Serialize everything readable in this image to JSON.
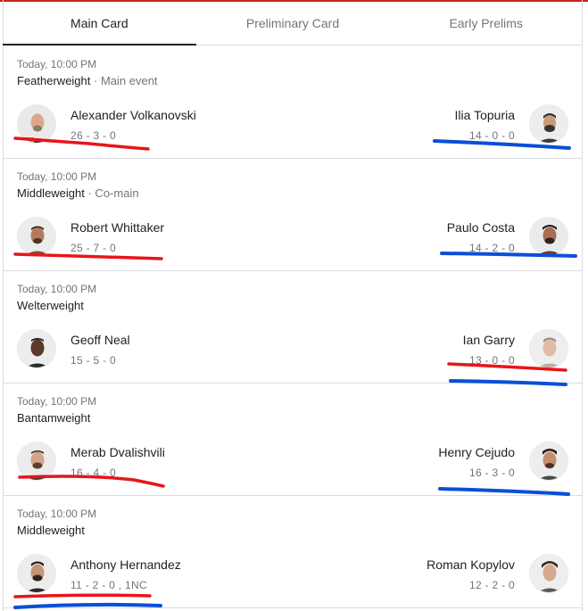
{
  "tabs": [
    {
      "label": "Main Card",
      "active": true
    },
    {
      "label": "Preliminary Card",
      "active": false
    },
    {
      "label": "Early Prelims",
      "active": false
    }
  ],
  "fights": [
    {
      "time": "Today, 10:00 PM",
      "division": "Featherweight",
      "note": " · Main event",
      "left": {
        "name": "Alexander Volkanovski",
        "record": "26 - 3 - 0"
      },
      "right": {
        "name": "Ilia Topuria",
        "record": "14 - 0 - 0"
      }
    },
    {
      "time": "Today, 10:00 PM",
      "division": "Middleweight",
      "note": " · Co-main",
      "left": {
        "name": "Robert Whittaker",
        "record": "25 - 7 - 0"
      },
      "right": {
        "name": "Paulo Costa",
        "record": "14 - 2 - 0"
      }
    },
    {
      "time": "Today, 10:00 PM",
      "division": "Welterweight",
      "note": "",
      "left": {
        "name": "Geoff Neal",
        "record": "15 - 5 - 0"
      },
      "right": {
        "name": "Ian Garry",
        "record": "13 - 0 - 0"
      }
    },
    {
      "time": "Today, 10:00 PM",
      "division": "Bantamweight",
      "note": "",
      "left": {
        "name": "Merab Dvalishvili",
        "record": "16 - 4 - 0"
      },
      "right": {
        "name": "Henry Cejudo",
        "record": "16 - 3 - 0"
      }
    },
    {
      "time": "Today, 10:00 PM",
      "division": "Middleweight",
      "note": "",
      "left": {
        "name": "Anthony Hernandez",
        "record": "11 - 2 - 0 , 1NC"
      },
      "right": {
        "name": "Roman Kopylov",
        "record": "12 - 2 - 0"
      }
    }
  ],
  "colors": {
    "red_marker": "#e8141b",
    "blue_marker": "#0a4fd6",
    "accent_top": "#c5221f"
  },
  "icons": {
    "avatar": "fighter-headshot-icon"
  }
}
